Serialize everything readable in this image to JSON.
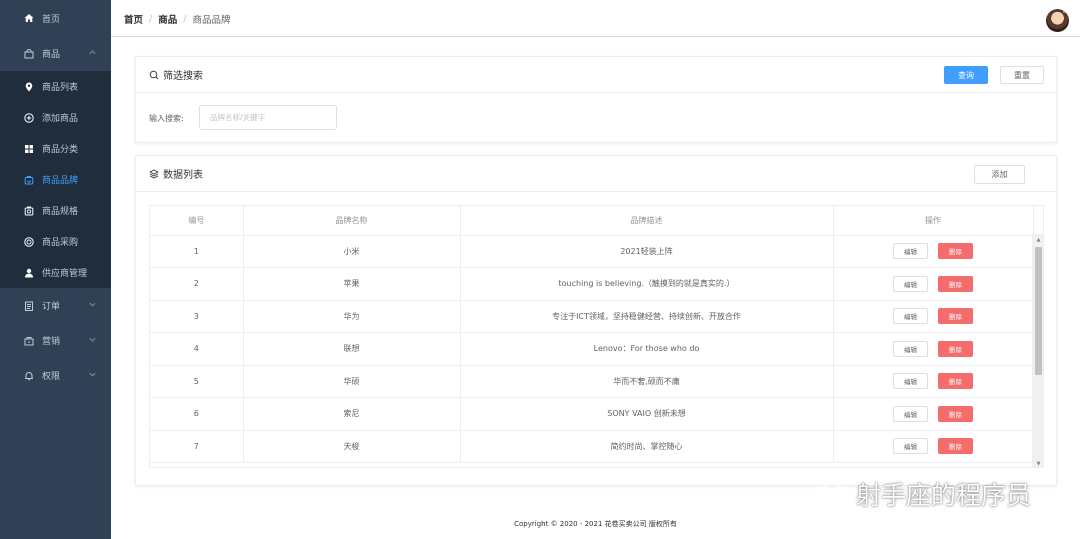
{
  "sidebar": {
    "items": [
      {
        "label": "首页",
        "icon": "home-icon"
      },
      {
        "label": "商品",
        "icon": "shopping-bag-icon",
        "expanded": true,
        "children": [
          {
            "label": "商品列表",
            "icon": "location-pin-icon"
          },
          {
            "label": "添加商品",
            "icon": "circle-plus-icon"
          },
          {
            "label": "商品分类",
            "icon": "grid-icon"
          },
          {
            "label": "商品品牌",
            "icon": "brand-icon",
            "active": true
          },
          {
            "label": "商品规格",
            "icon": "spec-icon"
          },
          {
            "label": "商品采购",
            "icon": "globe-icon"
          },
          {
            "label": "供应商管理",
            "icon": "user-icon"
          }
        ]
      },
      {
        "label": "订单",
        "icon": "order-icon"
      },
      {
        "label": "营销",
        "icon": "marketing-icon"
      },
      {
        "label": "权限",
        "icon": "bell-icon"
      }
    ]
  },
  "header": {
    "breadcrumb": [
      "首页",
      "商品",
      "商品品牌"
    ],
    "separator": "/"
  },
  "filter": {
    "title": "筛选搜索",
    "query_label": "查询",
    "reset_label": "重置",
    "search_label": "输入搜索:",
    "search_placeholder": "品牌名称/关键字",
    "search_value": ""
  },
  "list": {
    "title": "数据列表",
    "add_label": "添加",
    "columns": [
      "编号",
      "品牌名称",
      "品牌描述",
      "操作"
    ],
    "edit_label": "编辑",
    "delete_label": "删除",
    "rows": [
      {
        "id": "1",
        "name": "小米",
        "desc": "2021轻装上阵"
      },
      {
        "id": "2",
        "name": "苹果",
        "desc": "touching is believing.（触摸到的就是真实的.）"
      },
      {
        "id": "3",
        "name": "华为",
        "desc": "专注于ICT领域，坚持稳健经营、持续创新、开放合作"
      },
      {
        "id": "4",
        "name": "联想",
        "desc": "Lenovo：For those who do"
      },
      {
        "id": "5",
        "name": "华硕",
        "desc": "华而不奢,硕而不庸"
      },
      {
        "id": "6",
        "name": "索尼",
        "desc": "SONY VAIO 创新未想"
      },
      {
        "id": "7",
        "name": "天梭",
        "desc": "简约时尚、掌控随心"
      }
    ]
  },
  "footer": {
    "text": "Copyright © 2020 - 2021 花卷买卖公司 版权所有"
  },
  "watermark": {
    "text": "射手座的程序员"
  },
  "colors": {
    "sidebar_bg": "#304156",
    "submenu_bg": "#1f2d3d",
    "primary": "#409eff",
    "danger": "#f56c6c"
  }
}
